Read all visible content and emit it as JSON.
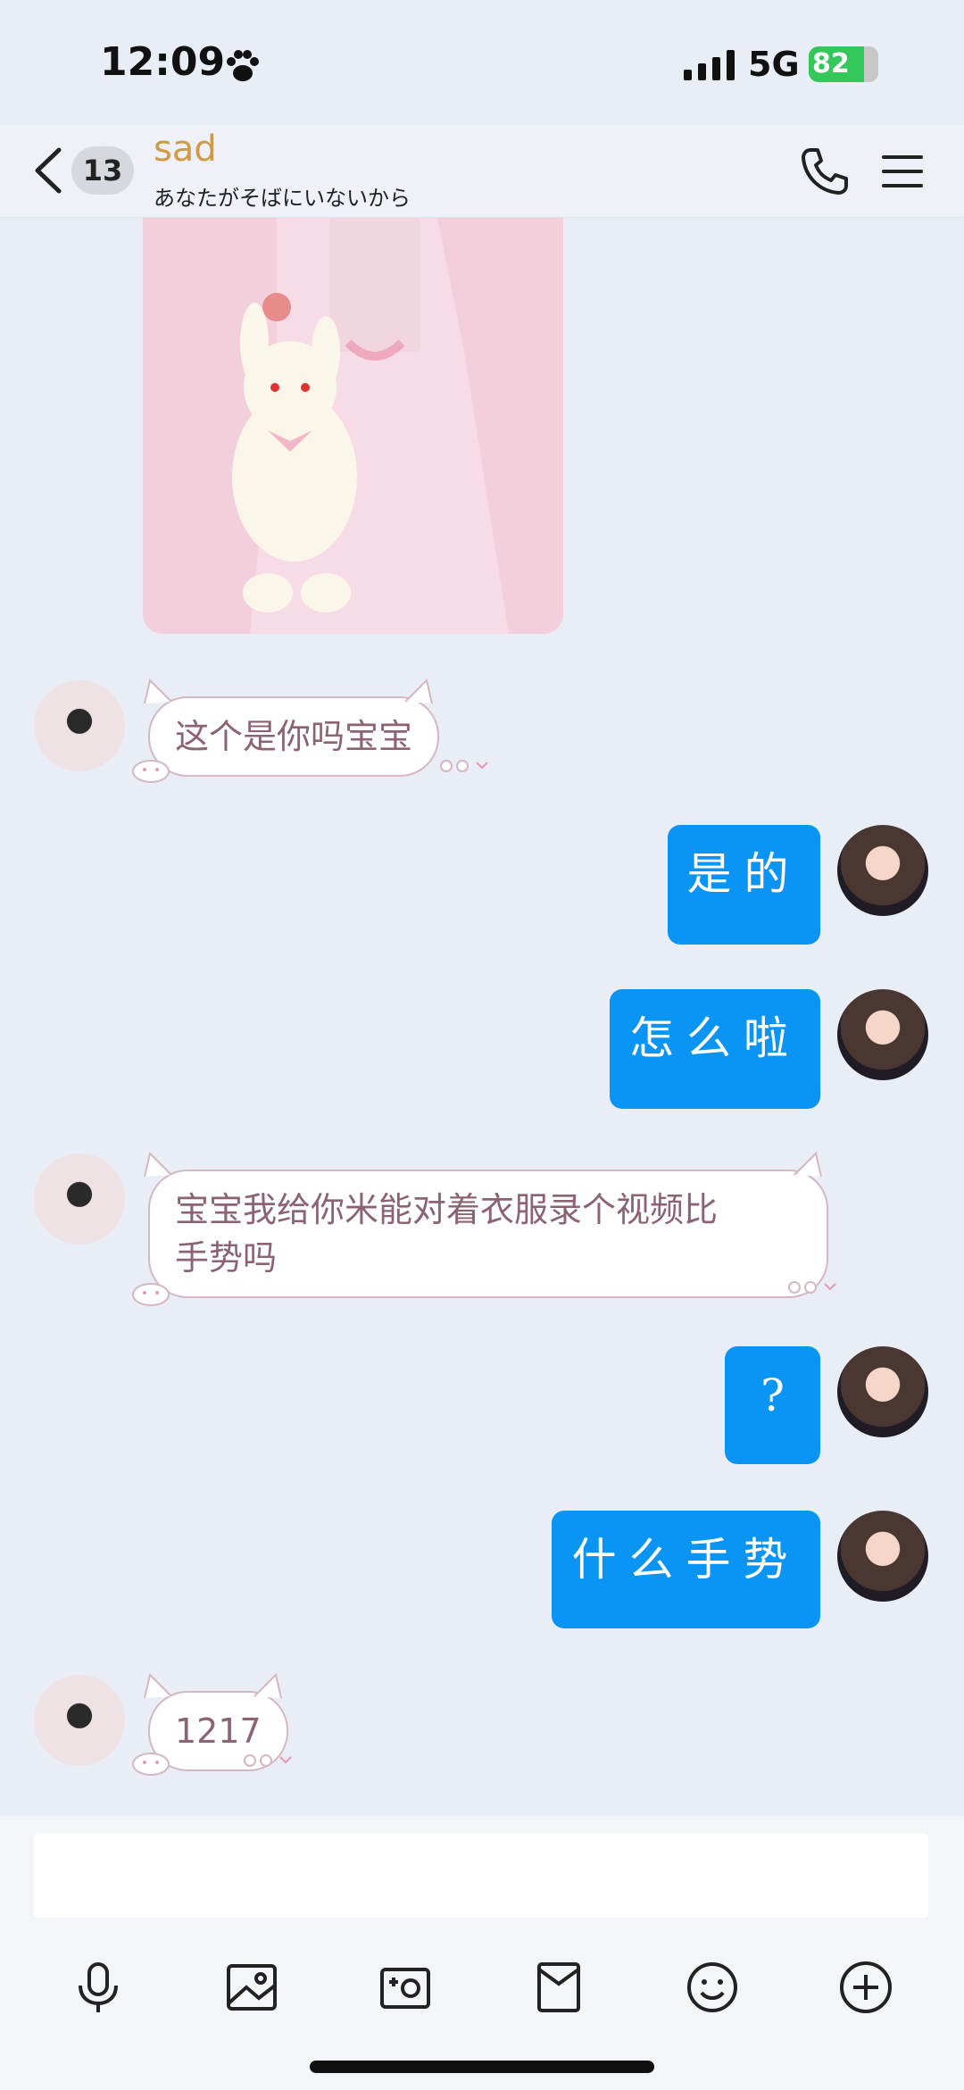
{
  "status_bar": {
    "time": "12:09",
    "network": "5G",
    "battery": "82"
  },
  "header": {
    "unread_count": "13",
    "name": "sad",
    "subtitle": "あなたがそばにいないから"
  },
  "messages": [
    {
      "side": "left",
      "type": "image",
      "description": "pink dress with plush bunny"
    },
    {
      "side": "left",
      "text": "这个是你吗宝宝"
    },
    {
      "side": "right",
      "text": "是的"
    },
    {
      "side": "right",
      "text": "怎么啦"
    },
    {
      "side": "left",
      "text_lines": [
        "宝宝我给你米能对着衣服录个视频比",
        "手势吗"
      ]
    },
    {
      "side": "right",
      "text": "?"
    },
    {
      "side": "right",
      "text": "什么手势"
    },
    {
      "side": "left",
      "text": "1217"
    }
  ],
  "input": {
    "placeholder": ""
  },
  "toolbar_icons": [
    "microphone-icon",
    "image-icon",
    "camera-icon",
    "red-packet-icon",
    "emoji-icon",
    "plus-icon"
  ],
  "colors": {
    "right_bubble": "#0a94f3",
    "background": "#e8edf6",
    "name_color": "#d19a47"
  }
}
